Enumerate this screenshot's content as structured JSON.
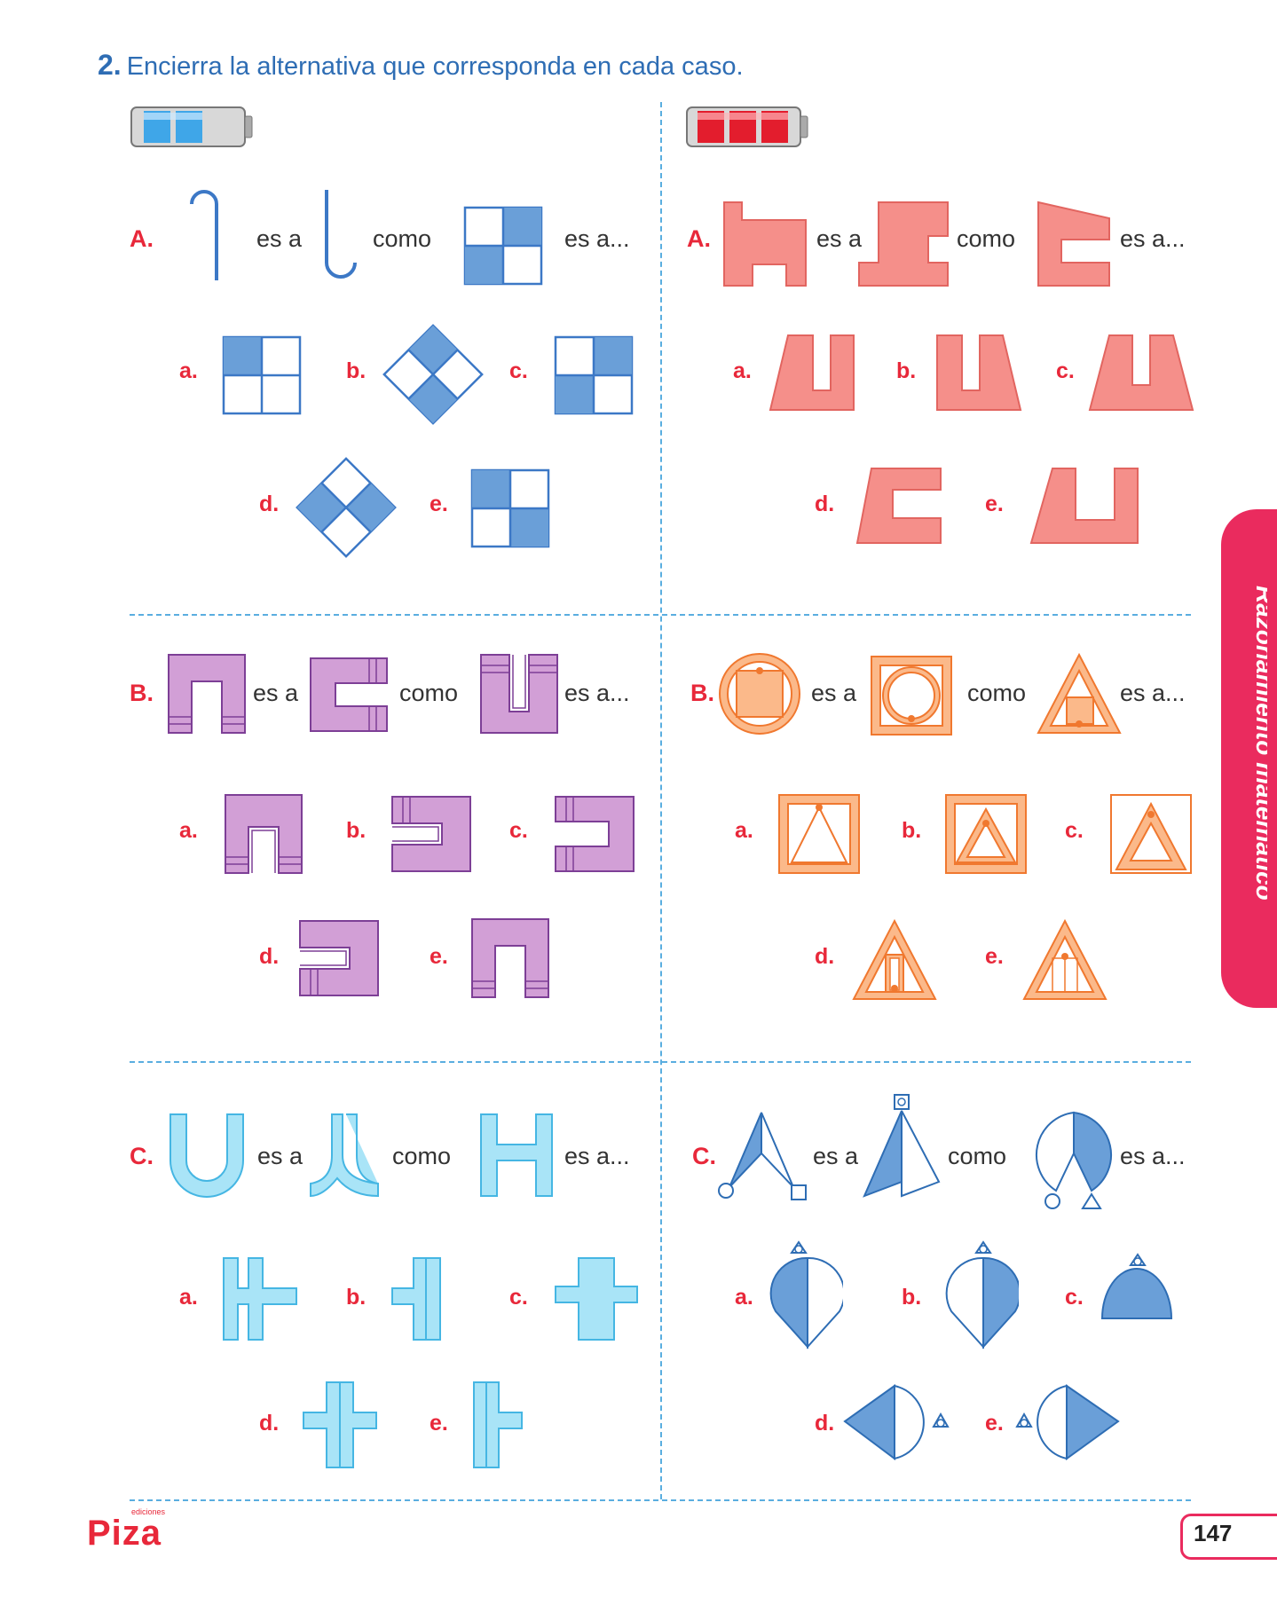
{
  "instruction": {
    "number": "2.",
    "text": "Encierra la alternativa que corresponda en cada caso."
  },
  "phrases": {
    "is_to": "es a",
    "as": "como",
    "is_to_end": "es a..."
  },
  "battery_left": {
    "level": 2,
    "color": "#3fa6e8"
  },
  "battery_right": {
    "level": 3,
    "color": "#e31d2d"
  },
  "problems_left": [
    {
      "label": "A.",
      "options": [
        "a.",
        "b.",
        "c.",
        "d.",
        "e."
      ]
    },
    {
      "label": "B.",
      "options": [
        "a.",
        "b.",
        "c.",
        "d.",
        "e."
      ]
    },
    {
      "label": "C.",
      "options": [
        "a.",
        "b.",
        "c.",
        "d.",
        "e."
      ]
    }
  ],
  "problems_right": [
    {
      "label": "A.",
      "options": [
        "a.",
        "b.",
        "c.",
        "d.",
        "e."
      ]
    },
    {
      "label": "B.",
      "options": [
        "a.",
        "b.",
        "c.",
        "d.",
        "e."
      ]
    },
    {
      "label": "C.",
      "options": [
        "a.",
        "b.",
        "c.",
        "d.",
        "e."
      ]
    }
  ],
  "side_tab": "Razonamiento matemático",
  "page_number": "147",
  "logo": {
    "small": "ediciones",
    "brand": "Piza"
  },
  "colors": {
    "accent": "#e8283a",
    "instruction": "#2e6db4",
    "divider": "#5aaee0",
    "tab": "#ea2b5e",
    "blue_fig": "#6a9fd8",
    "salmon_fig": "#f58f8a",
    "purple_fig": "#d29fd6",
    "orange_fig": "#fbb98a",
    "cyan_fig": "#a9e4f7"
  }
}
